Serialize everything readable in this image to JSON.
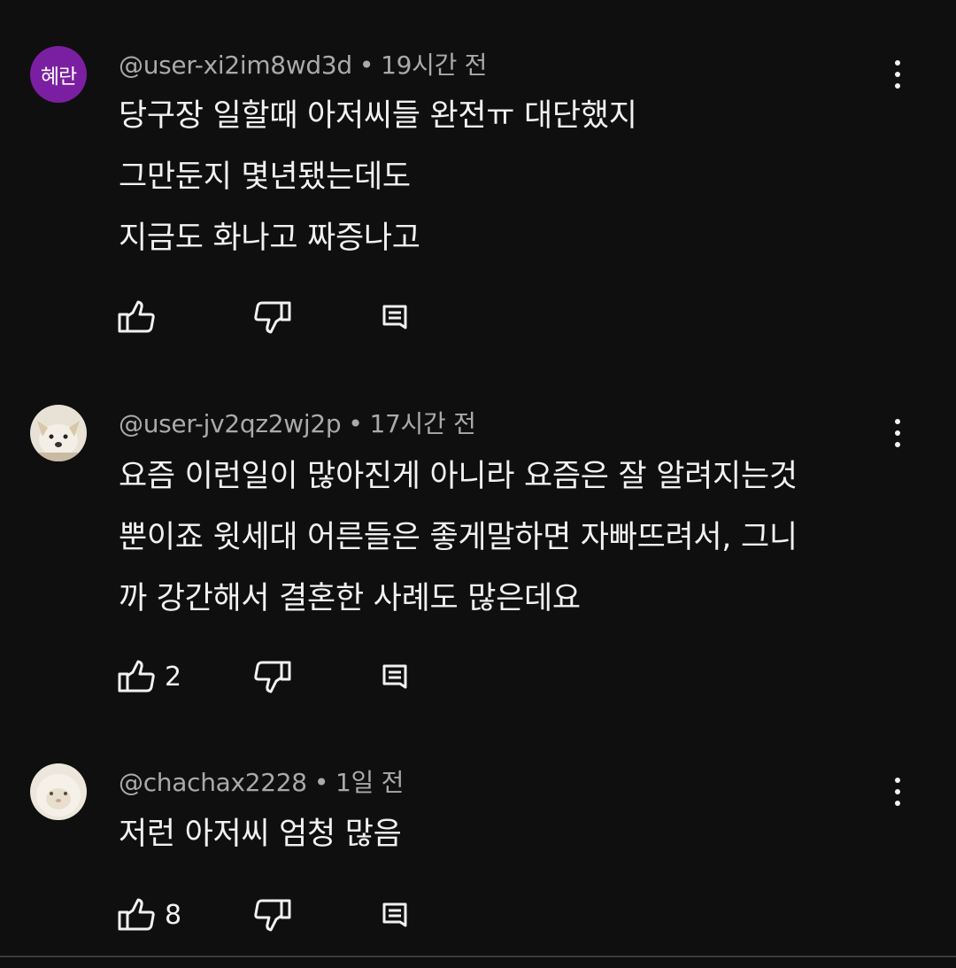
{
  "meta_separator": "•",
  "comments": [
    {
      "avatar_text": "혜란",
      "author": "@user-xi2im8wd3d",
      "time": "19시간 전",
      "text": "당구장 일할때  아저씨들 완전ㅠ 대단했지\n그만둔지 몇년됐는데도\n지금도 화나고 짜증나고",
      "like_count": ""
    },
    {
      "author": "@user-jv2qz2wj2p",
      "time": "17시간 전",
      "text": "요즘 이런일이 많아진게 아니라 요즘은 잘 알려지는것\n뿐이죠 윗세대 어른들은 좋게말하면 자빠뜨려서, 그니\n까 강간해서 결혼한 사례도 많은데요",
      "like_count": "2"
    },
    {
      "author": "@chachax2228",
      "time": "1일 전",
      "text": "저런 아저씨 엄청 많음",
      "like_count": "8"
    }
  ],
  "colors": {
    "background": "#0f0f0f",
    "text": "#f1f1f1",
    "meta": "#aaaaaa",
    "avatar_purple": "#7b1fa2"
  }
}
